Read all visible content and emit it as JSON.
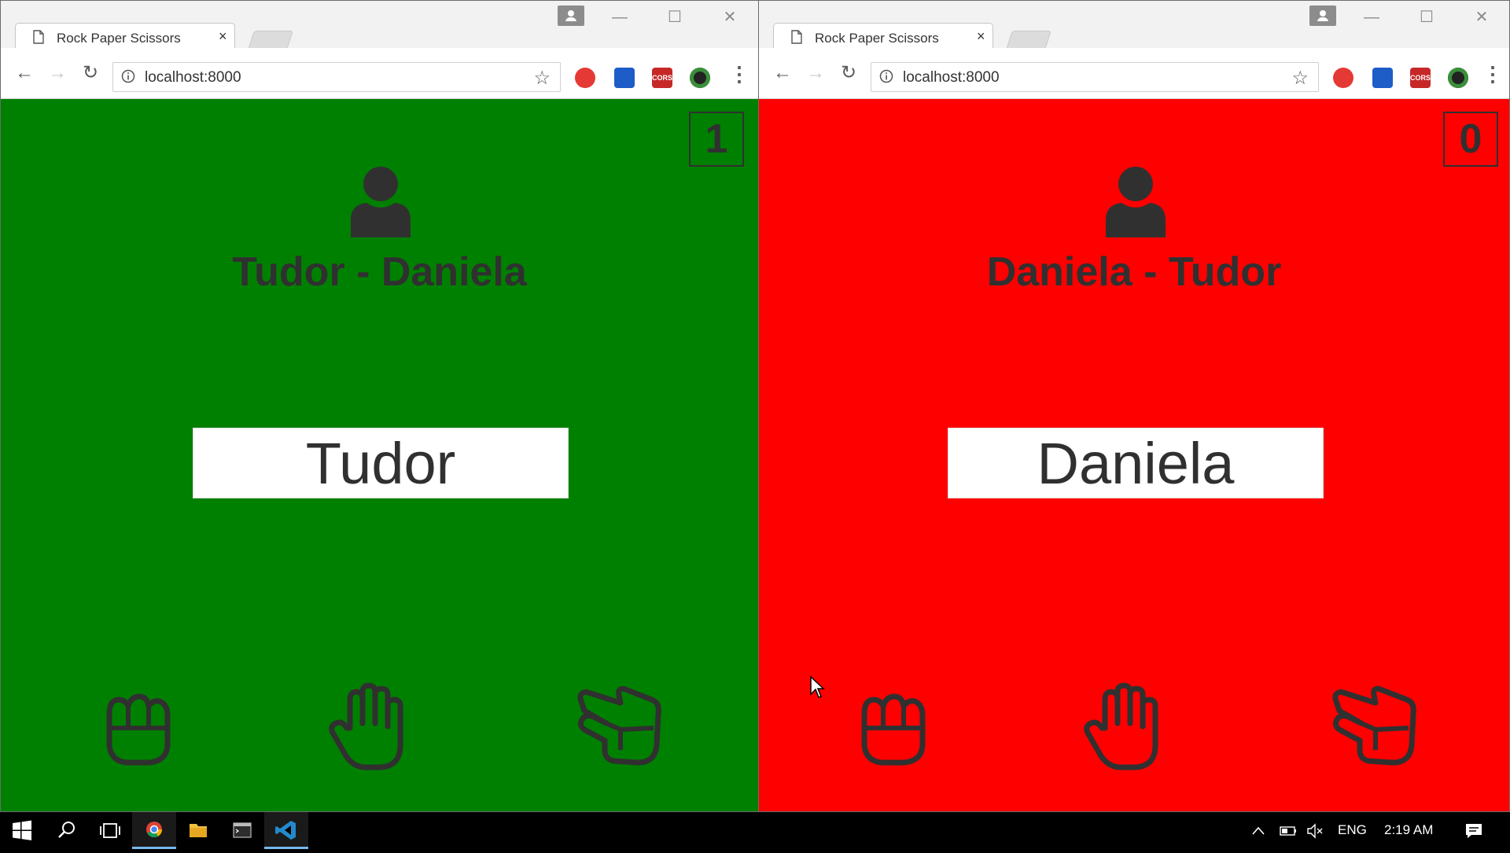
{
  "windows": [
    {
      "tab_title": "Rock Paper Scissors",
      "tab_close": "×",
      "url": "localhost:8000",
      "page": {
        "background": "#008000",
        "score": "1",
        "title": "Tudor - Daniela",
        "player_name": "Tudor"
      }
    },
    {
      "tab_title": "Rock Paper Scissors",
      "tab_close": "×",
      "url": "localhost:8000",
      "page": {
        "background": "#ff0000",
        "score": "0",
        "title": "Daniela - Tudor",
        "player_name": "Daniela"
      }
    }
  ],
  "window_controls": {
    "minimize": "—",
    "maximize": "☐",
    "close": "✕"
  },
  "nav": {
    "back": "←",
    "forward": "→",
    "reload": "↻",
    "star": "☆",
    "menu": "⋮"
  },
  "extensions": [
    {
      "name": "shield-extension-icon",
      "color": "#e53935"
    },
    {
      "name": "bookmark-extension-icon",
      "color": "#1e5cc8"
    },
    {
      "name": "cors-extension-icon",
      "color": "#c62828",
      "label": "CORS"
    },
    {
      "name": "camera-extension-icon",
      "color": "#222222"
    }
  ],
  "hands": [
    "rock-hand-icon",
    "paper-hand-icon",
    "scissors-hand-icon"
  ],
  "taskbar": {
    "apps": [
      "start-icon",
      "search-icon",
      "task-view-icon",
      "chrome-icon",
      "file-explorer-icon",
      "terminal-icon",
      "vscode-icon"
    ],
    "language": "ENG",
    "time": "2:19 AM"
  },
  "colors": {
    "text_dark": "#303030",
    "taskbar": "#000000",
    "taskbar_accent": "#76b9ed"
  }
}
